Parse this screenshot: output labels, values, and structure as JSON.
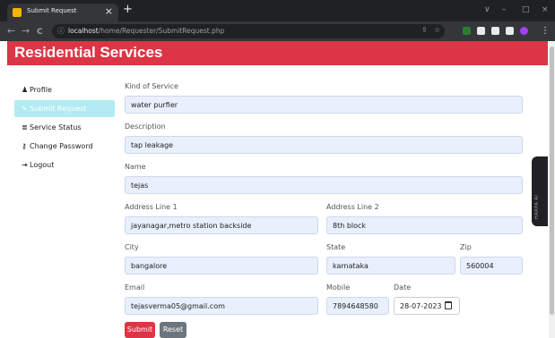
{
  "browser": {
    "tab_title": "Submit Request",
    "tab_close": "×",
    "new_tab": "+",
    "url_host": "localhost",
    "url_path": "/home/Requester/SubmitRequest.php",
    "window_controls": [
      "∨",
      "–",
      "□",
      "×"
    ],
    "nav": {
      "back": "←",
      "forward": "→",
      "reload": "C"
    },
    "menu_dots": "⋮",
    "extension_colors": [
      "#d93025",
      "#e8eaed",
      "#e8eaed",
      "#e8eaed",
      "#a142f4"
    ]
  },
  "header": {
    "brand": "Residential Services",
    "color": "#dc3545"
  },
  "sidebar": {
    "items": [
      {
        "icon": "user-icon",
        "glyph": "♟",
        "label": "Profile"
      },
      {
        "icon": "pen-icon",
        "glyph": "✎",
        "label": "Submit Request",
        "active": true
      },
      {
        "icon": "building-icon",
        "glyph": "≣",
        "label": "Service Status"
      },
      {
        "icon": "key-icon",
        "glyph": "⚷",
        "label": "Change Password"
      },
      {
        "icon": "logout-icon",
        "glyph": "⇥",
        "label": "Logout"
      }
    ]
  },
  "form": {
    "kind_of_service": {
      "label": "Kind of Service",
      "value": "water purfier"
    },
    "description": {
      "label": "Description",
      "value": "tap leakage"
    },
    "name": {
      "label": "Name",
      "value": "tejas"
    },
    "address1": {
      "label": "Address Line 1",
      "value": "jayanagar,metro station backside"
    },
    "address2": {
      "label": "Address Line 2",
      "value": "8th block"
    },
    "city": {
      "label": "City",
      "value": "bangalore"
    },
    "state": {
      "label": "State",
      "value": "karnataka"
    },
    "zip": {
      "label": "Zip",
      "value": "560004"
    },
    "email": {
      "label": "Email",
      "value": "tejasverma05@gmail.com"
    },
    "mobile": {
      "label": "Mobile",
      "value": "7894648580"
    },
    "date": {
      "label": "Date",
      "value": "28-07-2023"
    },
    "submit_label": "Submit",
    "reset_label": "Reset"
  },
  "side_widget": {
    "text": "HARPA AI"
  }
}
